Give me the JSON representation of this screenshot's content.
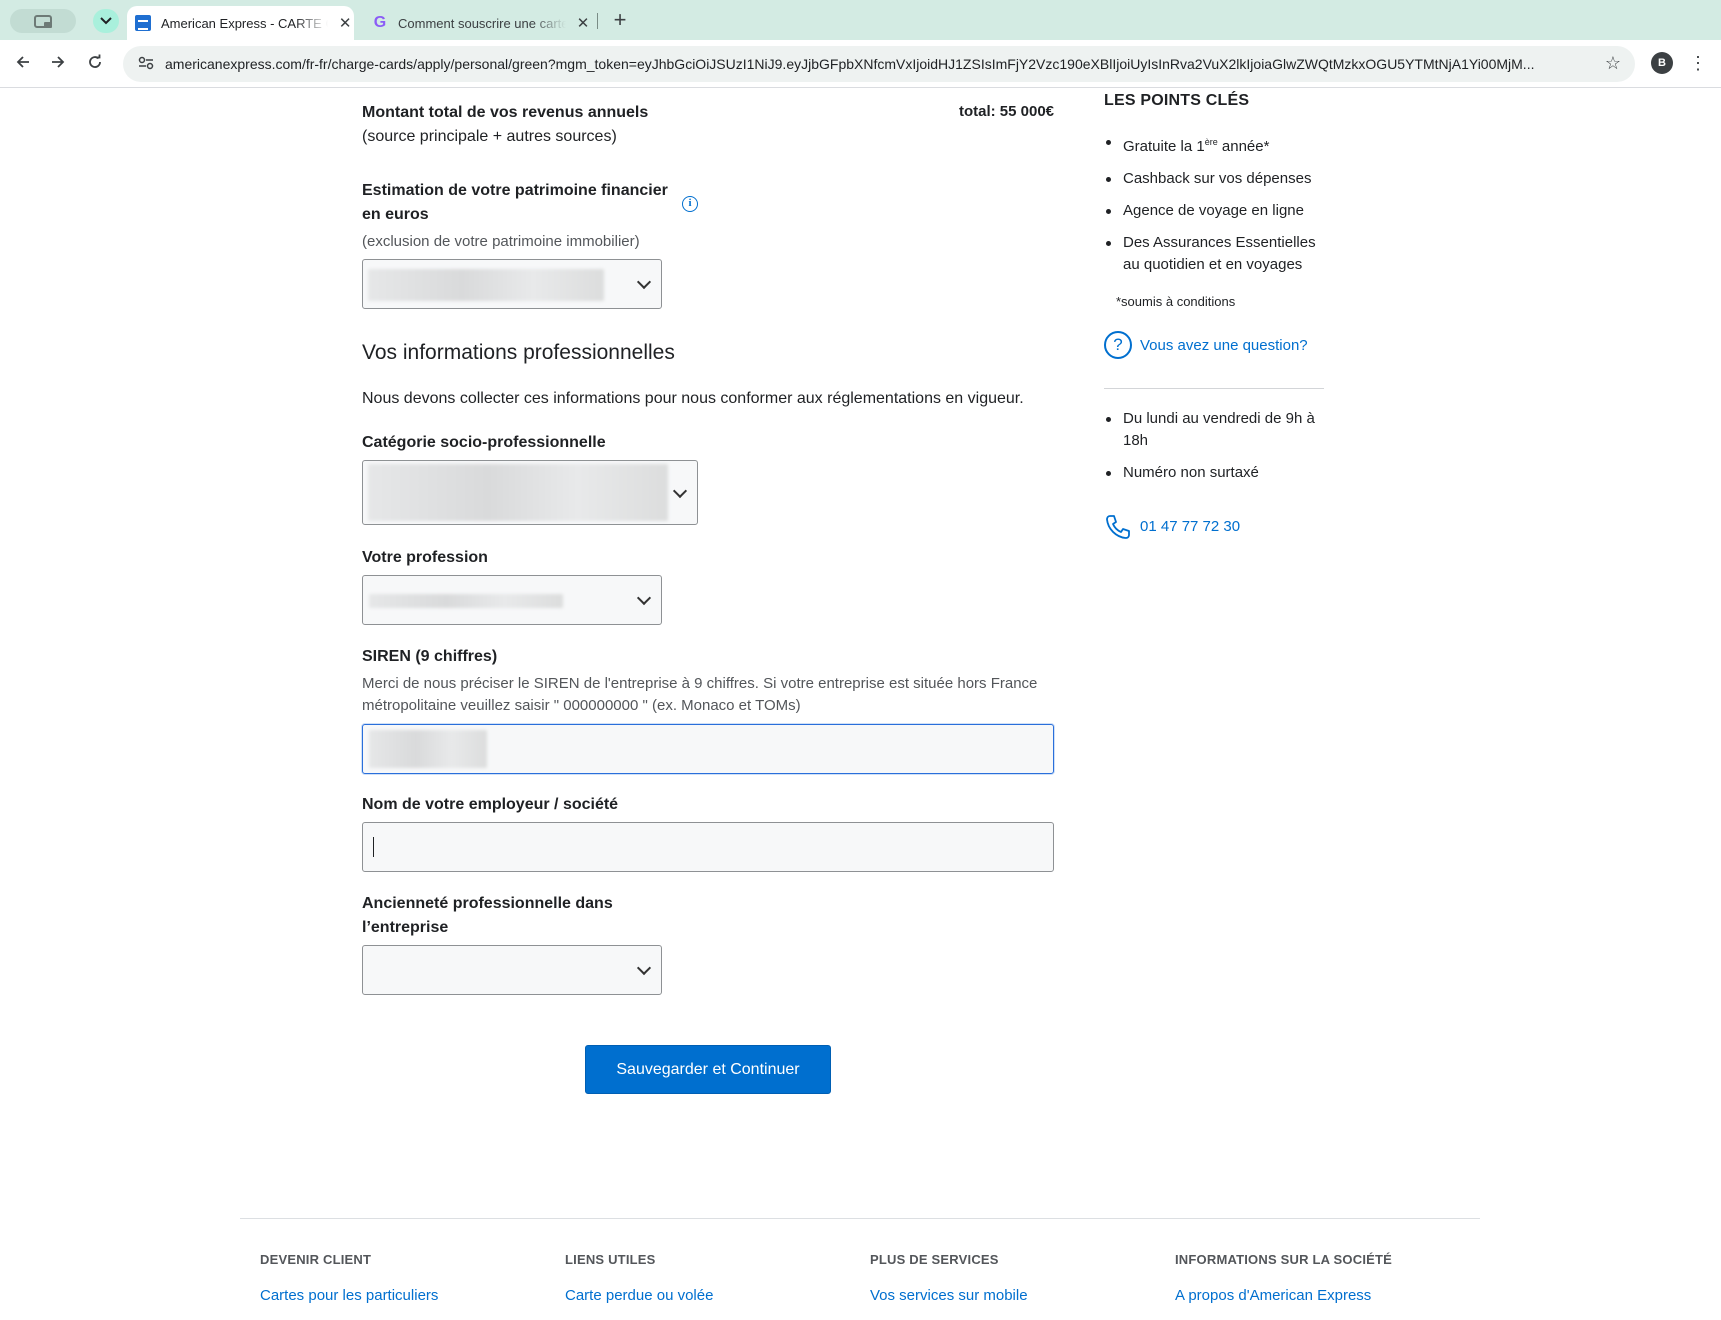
{
  "browser": {
    "tabs": [
      {
        "title": "American Express - CARTE GREEN",
        "close": "✕"
      },
      {
        "title": "Comment souscrire une carte",
        "close": "✕"
      }
    ],
    "new_tab": "+",
    "url": "americanexpress.com/fr-fr/charge-cards/apply/personal/green?mgm_token=eyJhbGciOiJSUzI1NiJ9.eyJjbGFpbXNfcmVxIjoidHJ1ZSIsImFjY2Vzc190eXBlIjoiUyIsInRva2VuX2lkIjoiaGlwZWQtMzkxOGU5YTMtNjA1Yi00MjM...",
    "profile_initial": "B"
  },
  "form": {
    "income": {
      "label": "Montant total de vos revenus annuels",
      "sublabel": "(source principale + autres sources)",
      "total": "total: 55 000€"
    },
    "wealth": {
      "label_line1": "Estimation de votre patrimoine financier",
      "label_line2": "en euros",
      "info": "i",
      "hint": "(exclusion de votre patrimoine immobilier)"
    },
    "professional": {
      "title": "Vos informations professionnelles",
      "description": "Nous devons collecter ces informations pour nous conformer aux réglementations en vigueur."
    },
    "category": {
      "label": "Catégorie socio-professionnelle"
    },
    "profession": {
      "label": "Votre profession"
    },
    "siren": {
      "label": "SIREN (9 chiffres)",
      "hint_line1": "Merci de nous préciser le SIREN de l'entreprise à 9 chiffres. Si votre entreprise est située hors France",
      "hint_line2": "métropolitaine veuillez saisir \" 000000000 \" (ex. Monaco et TOMs)"
    },
    "employer": {
      "label": "Nom de votre employeur / société",
      "value": ""
    },
    "seniority": {
      "label_line1": "Ancienneté professionnelle dans",
      "label_line2": "l’entreprise"
    },
    "submit_label": "Sauvegarder et Continuer"
  },
  "sidebar": {
    "title": "LES POINTS CLÉS",
    "points": [
      {
        "text": "Gratuite la 1",
        "sup": "ère",
        "after": " année*"
      },
      {
        "text": "Cashback sur vos dépenses"
      },
      {
        "text": "Agence de voyage en ligne"
      },
      {
        "text": "Des Assurances Essentielles au quotidien et en voyages"
      }
    ],
    "conditions": "*soumis à conditions",
    "question_icon": "?",
    "question_link": "Vous avez une question?",
    "hours": [
      "Du lundi au vendredi de 9h à 18h",
      "Numéro non surtaxé"
    ],
    "phone": "01 47 77 72 30"
  },
  "footer": {
    "columns": [
      {
        "heading": "DEVENIR CLIENT",
        "link": "Cartes pour les particuliers"
      },
      {
        "heading": "LIENS UTILES",
        "link": "Carte perdue ou volée"
      },
      {
        "heading": "PLUS DE SERVICES",
        "link": "Vos services sur mobile"
      },
      {
        "heading": "INFORMATIONS SUR LA SOCIÉTÉ",
        "link": "A propos d'American Express"
      }
    ]
  }
}
